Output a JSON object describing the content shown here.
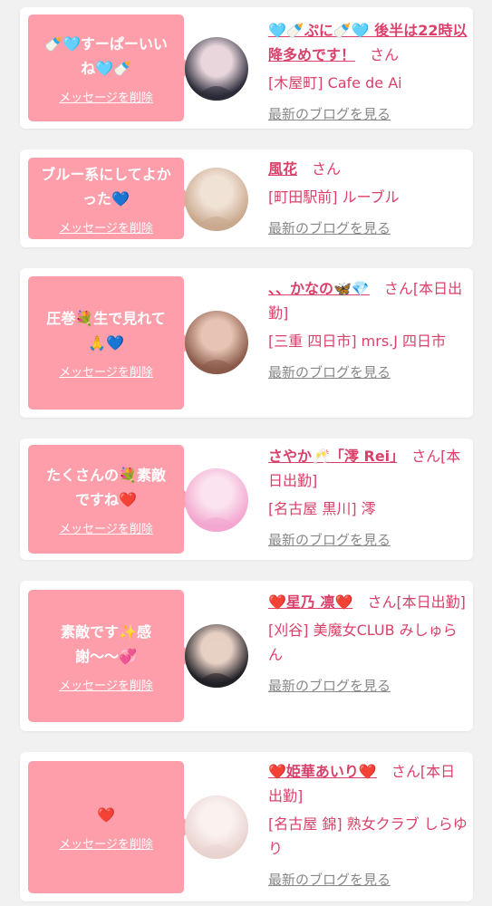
{
  "colors": {
    "bubble": "#fe9eab",
    "accent": "#d9416b",
    "link_gray": "#888888",
    "background": "#f1f1f1"
  },
  "common": {
    "delete_label": "メッセージを削除",
    "blog_label": "最新のブログを見る"
  },
  "messages": [
    {
      "message": "🍼🩵すーぱーいいね🩵🍼",
      "name": "🩵🍼ぷに🍼🩵 後半は22時以降多めです！",
      "honorific": "さん",
      "shop": "[木屋町] Cafe de Ai",
      "avatar_icon": "profile-photo-icon",
      "avatar_colors": [
        "#2a2a38",
        "#e8d6dc"
      ]
    },
    {
      "message": "ブルー系にしてよかった💙",
      "name": "風花",
      "honorific": "さん",
      "shop": "[町田駅前] ルーブル",
      "avatar_icon": "profile-photo-icon",
      "avatar_colors": [
        "#c9a98e",
        "#f1e2d6"
      ]
    },
    {
      "message": "圧巻💐生で見れて🙏💙",
      "name": "、、かなの🦋💎",
      "honorific": "さん[本日出勤]",
      "shop": "[三重 四日市] mrs.J 四日市",
      "avatar_icon": "profile-photo-icon",
      "avatar_colors": [
        "#8a5a4a",
        "#e6c3b3"
      ]
    },
    {
      "message": "たくさんの💐素敵ですね❤️",
      "name": "さやか🥂「澪 Rei」",
      "honorific": "さん[本日出勤]",
      "shop": "[名古屋 黒川] 澪",
      "avatar_icon": "profile-photo-icon",
      "avatar_colors": [
        "#f3a6cf",
        "#fbe3ef"
      ]
    },
    {
      "message": "素敵です✨感謝〜〜💞",
      "name": "❤️星乃 凛❤️",
      "honorific": "さん[本日出勤]",
      "shop": "[刈谷] 美魔女CLUB みしゅらん",
      "avatar_icon": "profile-photo-icon",
      "avatar_colors": [
        "#1f1f24",
        "#e7cfc4"
      ]
    },
    {
      "message": "❤️",
      "name": "❤️姫華あいり❤️",
      "honorific": "さん[本日出勤]",
      "shop": "[名古屋 錦] 熟女クラブ しらゆり",
      "avatar_icon": "profile-photo-icon",
      "avatar_colors": [
        "#e9d3cf",
        "#fbf2f0"
      ]
    }
  ]
}
